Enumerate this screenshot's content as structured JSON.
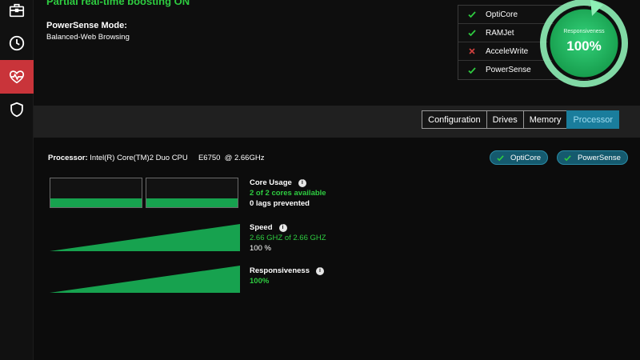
{
  "status": {
    "headline": "Partial real-time boosting ON",
    "mode_label": "PowerSense Mode:",
    "mode_value": "Balanced-Web Browsing"
  },
  "features": [
    {
      "label": "OptiCore",
      "enabled": true
    },
    {
      "label": "RAMJet",
      "enabled": true
    },
    {
      "label": "AcceleWrite",
      "enabled": false
    },
    {
      "label": "PowerSense",
      "enabled": true
    }
  ],
  "gauge": {
    "label": "Responsiveness",
    "value": "100%",
    "level": 1.0,
    "color": "#2ecc71"
  },
  "tabs": [
    {
      "label": "Configuration",
      "active": false
    },
    {
      "label": "Drives",
      "active": false
    },
    {
      "label": "Memory",
      "active": false
    },
    {
      "label": "Processor",
      "active": true
    }
  ],
  "processor": {
    "label": "Processor:",
    "name": "Intel(R) Core(TM)2 Duo CPU     E6750  @ 2.66GHz",
    "pills": [
      "OptiCore",
      "PowerSense"
    ],
    "cores": [
      {
        "usage": 0.3
      },
      {
        "usage": 0.3
      }
    ],
    "core_usage": {
      "title": "Core Usage",
      "line1": "2 of 2 cores available",
      "line2": "0 lags prevented"
    },
    "speed": {
      "title": "Speed",
      "line1": "2.66 GHZ of 2.66 GHZ",
      "line2": "100 %",
      "level": 1.0
    },
    "responsiveness": {
      "title": "Responsiveness",
      "line1": "100%",
      "level": 1.0
    }
  },
  "colors": {
    "accent_green": "#2ecc40",
    "bar_green": "#17a24f",
    "active_tab": "#1a7d9c",
    "active_nav": "#c9343a",
    "error_red": "#d0413f"
  },
  "icons": {
    "nav": [
      "toolbox-icon",
      "clock-icon",
      "heart-pulse-icon",
      "shield-icon"
    ]
  }
}
